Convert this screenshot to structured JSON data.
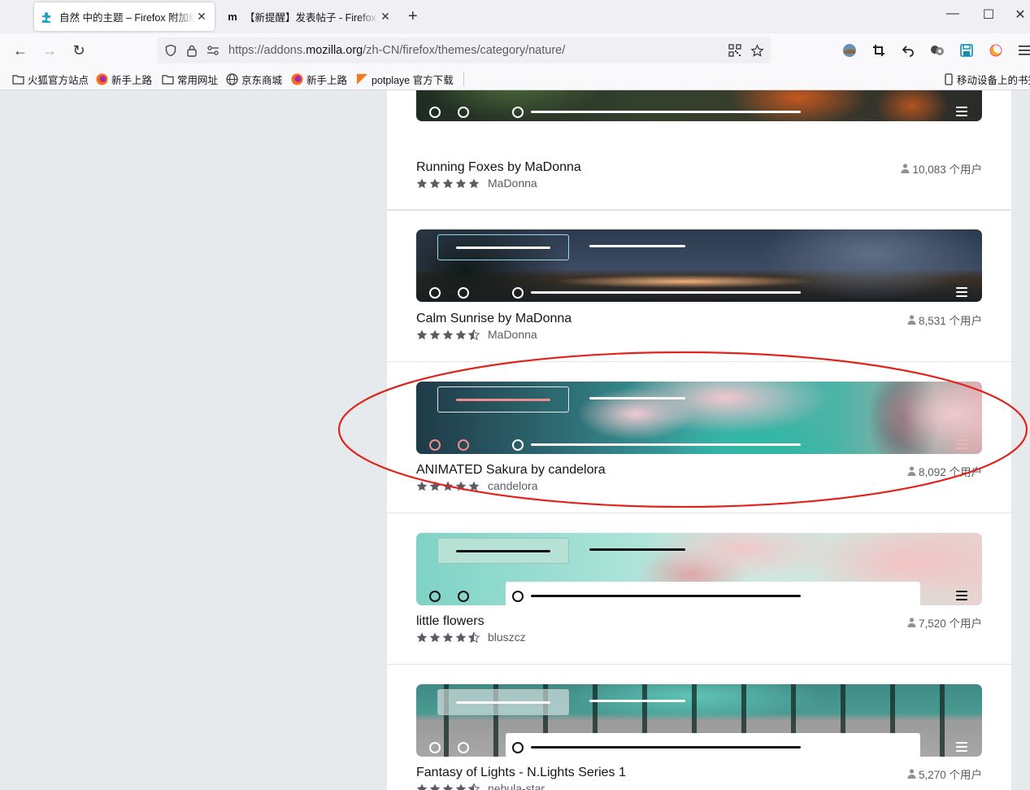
{
  "browser": {
    "tabs": [
      {
        "title": "自然 中的主题 – Firefox 附加组件",
        "favicon": "puzzle-icon",
        "active": true
      },
      {
        "title": "【新提醒】发表帖子 - Firefox 火狐",
        "favicon": "m-icon",
        "active": false
      }
    ],
    "new_tab": "+",
    "url_prefix": "https://addons.",
    "url_domain": "mozilla.org",
    "url_path": "/zh-CN/firefox/themes/category/nature/",
    "bookmarks": [
      {
        "label": "火狐官方站点",
        "icon": "folder-icon"
      },
      {
        "label": "新手上路",
        "icon": "firefox-icon"
      },
      {
        "label": "常用网址",
        "icon": "folder-icon"
      },
      {
        "label": "京东商城",
        "icon": "globe-icon"
      },
      {
        "label": "新手上路",
        "icon": "firefox-icon"
      },
      {
        "label": "potplaye 官方下载",
        "icon": "potplayer-icon"
      }
    ],
    "mobile_bookmarks": "移动设备上的书签"
  },
  "themes": [
    {
      "name": "Running Foxes by MaDonna",
      "author": "MaDonna",
      "users": "10,083 个用户",
      "rating": 5
    },
    {
      "name": "Calm Sunrise by MaDonna",
      "author": "MaDonna",
      "users": "8,531 个用户",
      "rating": 4.5
    },
    {
      "name": "ANIMATED Sakura by candelora",
      "author": "candelora",
      "users": "8,092 个用户",
      "rating": 5
    },
    {
      "name": "little flowers",
      "author": "bluszcz",
      "users": "7,520 个用户",
      "rating": 4.5
    },
    {
      "name": "Fantasy of Lights - N.Lights Series 1",
      "author": "nebula-star",
      "users": "5,270 个用户",
      "rating": 4.5
    }
  ],
  "colors": {
    "annotation": "#e0231b",
    "star": "#5b5b66",
    "accent": "#0060df"
  }
}
